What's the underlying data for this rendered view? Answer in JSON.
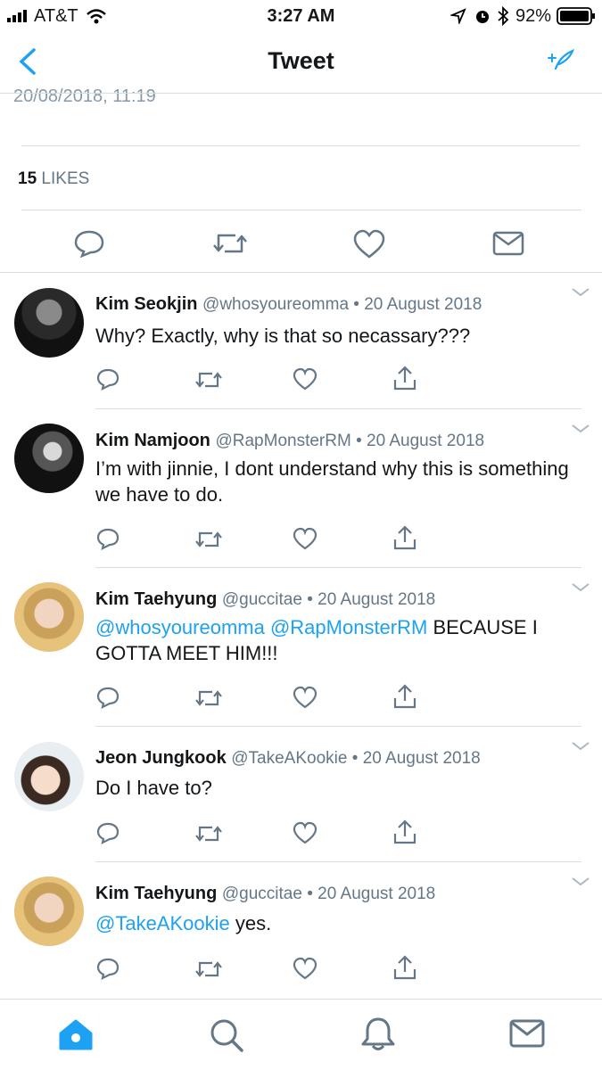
{
  "status_bar": {
    "carrier": "AT&T",
    "time": "3:27 AM",
    "battery": "92%"
  },
  "nav": {
    "title": "Tweet"
  },
  "tweet": {
    "timestamp": "20/08/2018, 11:19",
    "likes_count": "15",
    "likes_label": "LIKES"
  },
  "replies": [
    {
      "name": "Kim Seokjin",
      "handle": "@whosyoureomma",
      "sep": " • ",
      "date": "20 August 2018",
      "mentions": "",
      "text": "Why? Exactly, why is that so necassary???"
    },
    {
      "name": "Kim Namjoon",
      "handle": "@RapMonsterRM",
      "sep": " • ",
      "date": "20 August 2018",
      "mentions": "",
      "text": "I’m with jinnie, I dont understand why this is something we have to do."
    },
    {
      "name": "Kim Taehyung",
      "handle": "@guccitae",
      "sep": " • ",
      "date": "20 August 2018",
      "mentions": "@whosyoureomma @RapMonsterRM",
      "text": " BECAUSE I GOTTA MEET HIM!!!"
    },
    {
      "name": "Jeon Jungkook",
      "handle": "@TakeAKookie",
      "sep": " • ",
      "date": "20 August 2018",
      "mentions": "",
      "text": "Do I have to?"
    },
    {
      "name": "Kim Taehyung",
      "handle": "@guccitae",
      "sep": " • ",
      "date": "20 August 2018",
      "mentions": "@TakeAKookie",
      "text": " yes."
    }
  ],
  "colors": {
    "accent": "#1da1f2",
    "secondary_text": "#657786",
    "divider": "#d8dde2"
  },
  "icons": {
    "status": [
      "signal-icon",
      "wifi-icon",
      "location-arrow-icon",
      "alarm-icon",
      "bluetooth-icon",
      "battery-icon"
    ],
    "nav": [
      "back-chevron-icon",
      "compose-tweet-icon"
    ],
    "tweet_actions": [
      "reply-icon",
      "retweet-icon",
      "like-icon",
      "direct-message-icon"
    ],
    "reply_actions": [
      "reply-icon",
      "retweet-icon",
      "like-icon",
      "share-icon"
    ],
    "tab_bar": [
      "home-icon",
      "search-icon",
      "notifications-icon",
      "messages-icon"
    ]
  }
}
